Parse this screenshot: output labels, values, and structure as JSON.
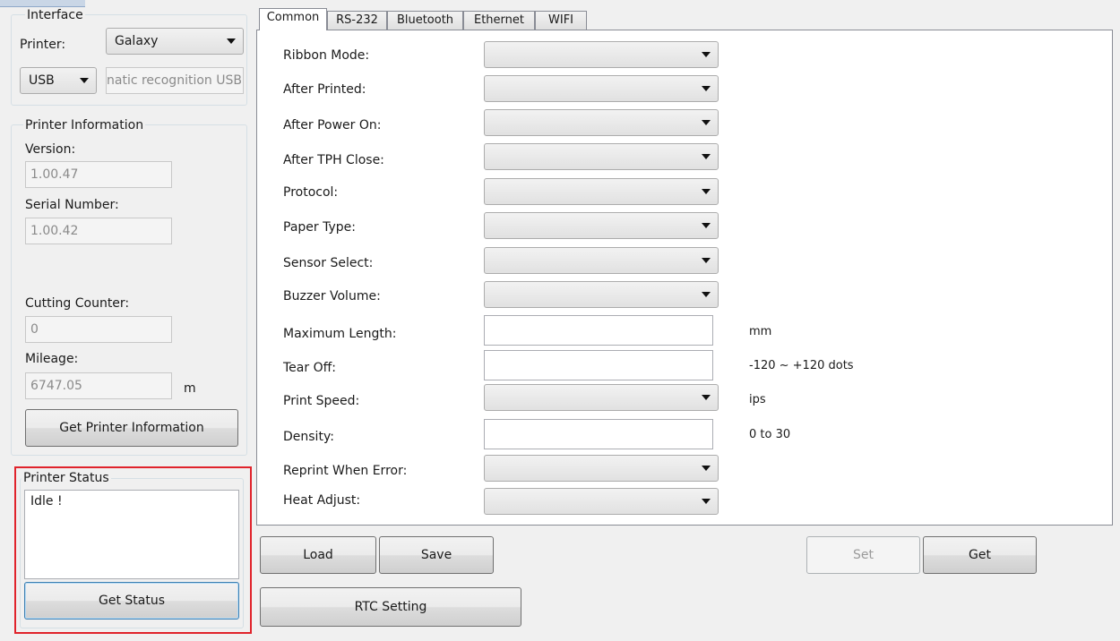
{
  "left_panel": {
    "interface": {
      "title": "Interface",
      "printer_label": "Printer:",
      "printer_value": "Galaxy",
      "port_value": "USB",
      "port_info": "natic recognition USB"
    },
    "printer_information": {
      "title": "Printer Information",
      "version_label": "Version:",
      "version_value": "1.00.47",
      "serial_label": "Serial Number:",
      "serial_value": "1.00.42",
      "cutting_label": "Cutting Counter:",
      "cutting_value": "0",
      "mileage_label": "Mileage:",
      "mileage_value": "6747.05",
      "mileage_unit": "m",
      "get_info_button": "Get Printer Information"
    },
    "printer_status": {
      "title": "Printer Status",
      "status_text": "Idle !",
      "get_status_button": "Get Status"
    }
  },
  "tabs": [
    "Common",
    "RS-232",
    "Bluetooth",
    "Ethernet",
    "WIFI"
  ],
  "active_tab": "Common",
  "settings": {
    "ribbon_mode": "Ribbon Mode:",
    "after_printed": "After Printed:",
    "after_power_on": "After Power On:",
    "after_tph_close": "After TPH Close:",
    "protocol": "Protocol:",
    "paper_type": "Paper Type:",
    "sensor_select": "Sensor Select:",
    "buzzer_volume": "Buzzer Volume:",
    "maximum_length": "Maximum Length:",
    "maximum_length_unit": "mm",
    "tear_off": "Tear Off:",
    "tear_off_range": "-120 ~ +120 dots",
    "print_speed": "Print Speed:",
    "print_speed_unit": "ips",
    "density": "Density:",
    "density_range": "0 to 30",
    "reprint_when_error": "Reprint When Error:",
    "heat_adjust": "Heat Adjust:"
  },
  "buttons": {
    "load": "Load",
    "save": "Save",
    "set": "Set",
    "get": "Get",
    "rtc_setting": "RTC Setting"
  },
  "colors": {
    "highlight_border": "#e0232b",
    "focus_border": "#3c7fb1"
  }
}
